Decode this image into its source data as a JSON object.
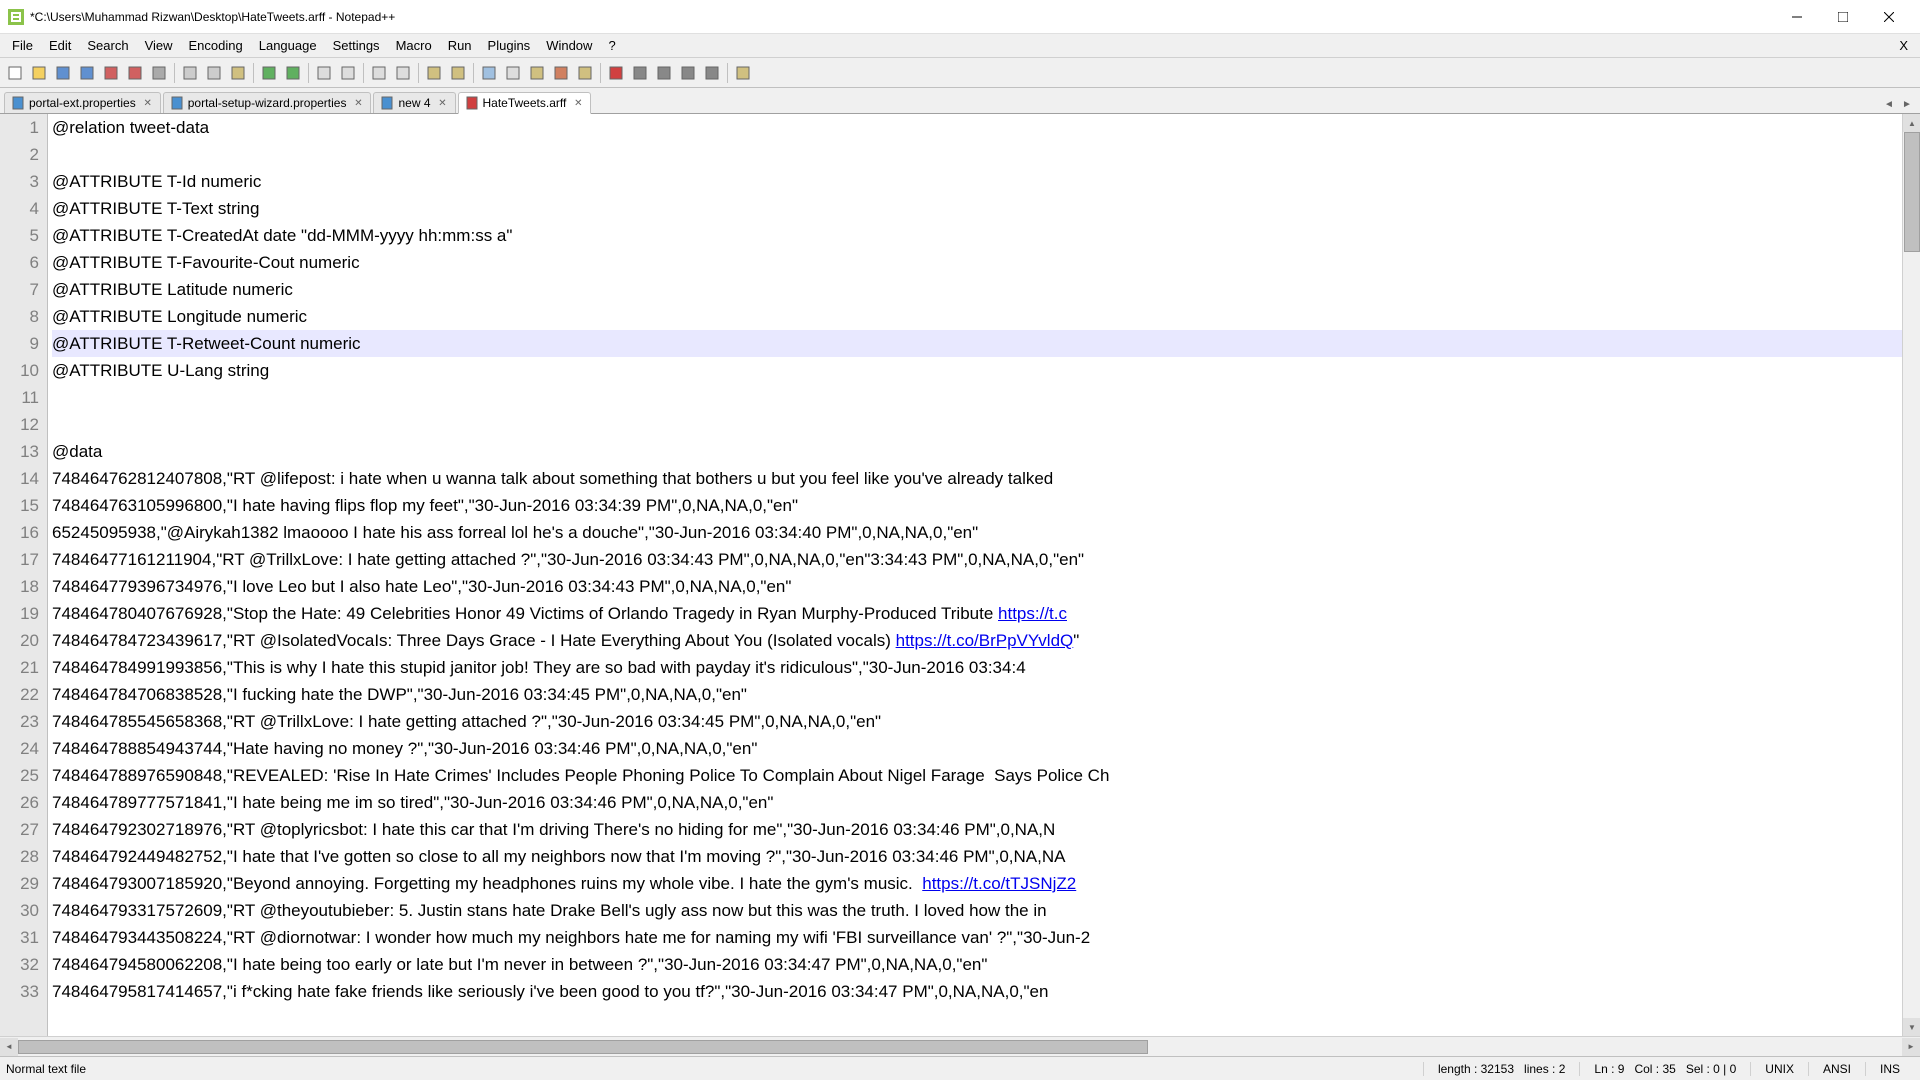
{
  "title": "*C:\\Users\\Muhammad Rizwan\\Desktop\\HateTweets.arff - Notepad++",
  "menus": [
    "File",
    "Edit",
    "Search",
    "View",
    "Encoding",
    "Language",
    "Settings",
    "Macro",
    "Run",
    "Plugins",
    "Window",
    "?"
  ],
  "menu_close": "X",
  "tabs": [
    {
      "label": "portal-ext.properties",
      "active": false,
      "icon": "blue"
    },
    {
      "label": "portal-setup-wizard.properties",
      "active": false,
      "icon": "blue"
    },
    {
      "label": "new 4",
      "active": false,
      "icon": "blue"
    },
    {
      "label": "HateTweets.arff",
      "active": true,
      "icon": "red"
    }
  ],
  "gutter_start": 1,
  "gutter_end": 33,
  "current_line": 9,
  "lines": [
    "@relation tweet-data",
    "",
    "@ATTRIBUTE T-Id numeric",
    "@ATTRIBUTE T-Text string",
    "@ATTRIBUTE T-CreatedAt date \"dd-MMM-yyyy hh:mm:ss a\"",
    "@ATTRIBUTE T-Favourite-Cout numeric",
    "@ATTRIBUTE Latitude numeric",
    "@ATTRIBUTE Longitude numeric",
    "@ATTRIBUTE T-Retweet-Count numeric",
    "@ATTRIBUTE U-Lang string",
    "",
    "",
    "@data",
    "748464762812407808,\"RT @lifepost: i hate when u wanna talk about something that bothers u but you feel like you've already talked",
    "748464763105996800,\"I hate having flips flop my feet\",\"30-Jun-2016 03:34:39 PM\",0,NA,NA,0,\"en\"",
    "65245095938,\"@Airykah1382 lmaoooo I hate his ass forreal lol he's a douche\",\"30-Jun-2016 03:34:40 PM\",0,NA,NA,0,\"en\"",
    "74846477161211904,\"RT @TrillxLove: I hate getting attached ?\",\"30-Jun-2016 03:34:43 PM\",0,NA,NA,0,\"en\"3:34:43 PM\",0,NA,NA,0,\"en\"",
    "748464779396734976,\"I love Leo but I also hate Leo\",\"30-Jun-2016 03:34:43 PM\",0,NA,NA,0,\"en\"",
    "748464780407676928,\"Stop the Hate: 49 Celebrities Honor 49 Victims of Orlando Tragedy in Ryan Murphy-Produced Tribute https://t.c",
    "748464784723439617,\"RT @IsolatedVocaIs: Three Days Grace - I Hate Everything About You (Isolated vocals) https://t.co/BrPpVYvldQ\"",
    "748464784991993856,\"This is why I hate this stupid janitor job! They are so bad with payday it's ridiculous\",\"30-Jun-2016 03:34:4",
    "748464784706838528,\"I fucking hate the DWP\",\"30-Jun-2016 03:34:45 PM\",0,NA,NA,0,\"en\"",
    "748464785545658368,\"RT @TrillxLove: I hate getting attached ?\",\"30-Jun-2016 03:34:45 PM\",0,NA,NA,0,\"en\"",
    "748464788854943744,\"Hate having no money ?\",\"30-Jun-2016 03:34:46 PM\",0,NA,NA,0,\"en\"",
    "748464788976590848,\"REVEALED: 'Rise In Hate Crimes' Includes People Phoning Police To Complain About Nigel Farage  Says Police Ch",
    "748464789777571841,\"I hate being me im so tired\",\"30-Jun-2016 03:34:46 PM\",0,NA,NA,0,\"en\"",
    "748464792302718976,\"RT @toplyricsbot: I hate this car that I'm driving There's no hiding for me\",\"30-Jun-2016 03:34:46 PM\",0,NA,N",
    "748464792449482752,\"I hate that I've gotten so close to all my neighbors now that I'm moving ?\",\"30-Jun-2016 03:34:46 PM\",0,NA,NA",
    "748464793007185920,\"Beyond annoying. Forgetting my headphones ruins my whole vibe. I hate the gym's music.  https://t.co/tTJSNjZ2",
    "748464793317572609,\"RT @theyoutubieber: 5. Justin stans hate Drake Bell's ugly ass now but this was the truth. I loved how the in",
    "748464793443508224,\"RT @diornotwar: I wonder how much my neighbors hate me for naming my wifi 'FBI surveillance van' ?\",\"30-Jun-2",
    "748464794580062208,\"I hate being too early or late but I'm never in between ?\",\"30-Jun-2016 03:34:47 PM\",0,NA,NA,0,\"en\"",
    "748464795817414657,\"i f*cking hate fake friends like seriously i've been good to you tf?\",\"30-Jun-2016 03:34:47 PM\",0,NA,NA,0,\"en"
  ],
  "links": [
    {
      "line_idx": 18,
      "text": "https://t.c"
    },
    {
      "line_idx": 19,
      "text": "https://t.co/BrPpVYvldQ"
    },
    {
      "line_idx": 28,
      "text": "https://t.co/tTJSNjZ2"
    }
  ],
  "status": {
    "filetype": "Normal text file",
    "length": "length : 32153",
    "lines": "lines : 2",
    "ln": "Ln : 9",
    "col": "Col : 35",
    "sel": "Sel : 0 | 0",
    "eol": "UNIX",
    "encoding": "ANSI",
    "mode": "INS"
  },
  "toolbar_icons": [
    "new-file",
    "open-file",
    "save",
    "save-all",
    "close",
    "close-all",
    "print",
    "sep",
    "cut",
    "copy",
    "paste",
    "sep",
    "undo",
    "redo",
    "sep",
    "find",
    "replace",
    "sep",
    "zoom-in",
    "zoom-out",
    "sep",
    "sync-v",
    "sync-h",
    "sep",
    "wrap",
    "show-all",
    "indent",
    "fold",
    "unfold",
    "sep",
    "record-macro",
    "stop-macro",
    "play-macro",
    "run-multiple",
    "save-macro",
    "sep",
    "monitor"
  ]
}
